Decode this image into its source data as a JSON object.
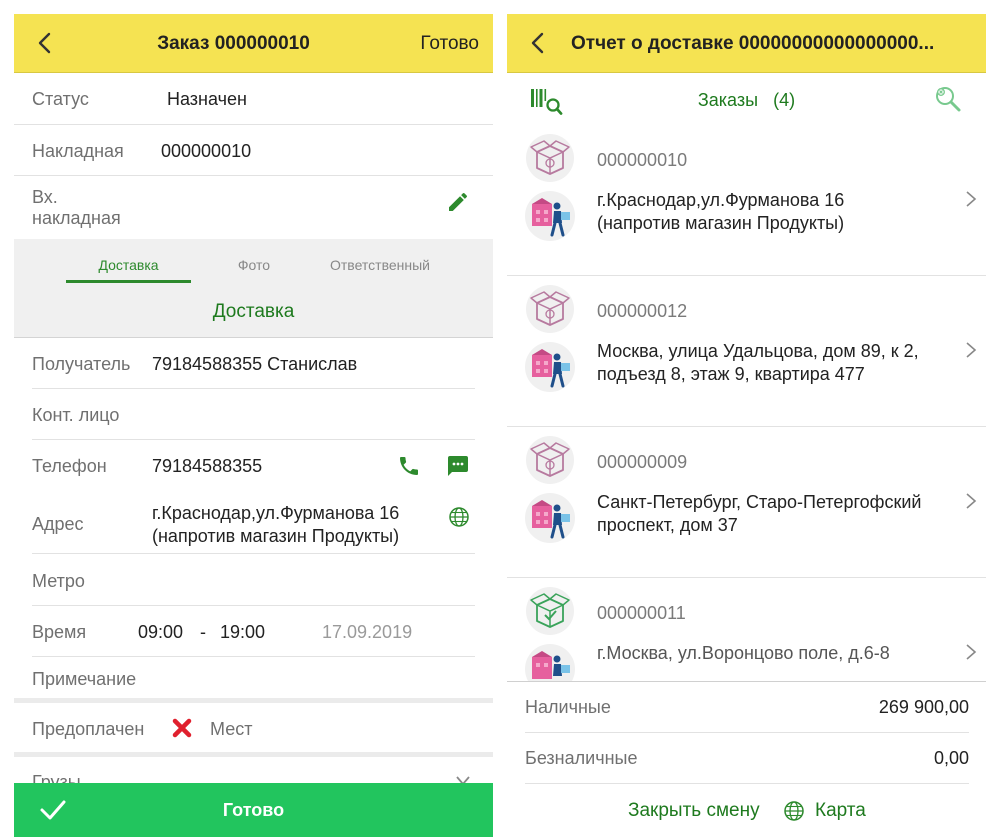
{
  "colors": {
    "header": "#f5e352",
    "accent_green": "#1e7a1e",
    "button_green": "#22c55e",
    "cancel_red": "#e0202e"
  },
  "order_screen": {
    "title": "Заказ 000000010",
    "done_label": "Готово",
    "status_label": "Статус",
    "status_value": "Назначен",
    "invoice_label": "Накладная",
    "invoice_value": "000000010",
    "incoming_invoice_label_line1": "Вх.",
    "incoming_invoice_label_line2": "накладная",
    "tabs": [
      {
        "label": "Доставка"
      },
      {
        "label": "Фото"
      },
      {
        "label": "Ответственный"
      }
    ],
    "active_tab": "Доставка",
    "section_title": "Доставка",
    "recipient_label": "Получатель",
    "recipient_value": "79184588355 Станислав",
    "contact_label": "Конт. лицо",
    "phone_label": "Телефон",
    "phone_value": "79184588355",
    "address_label": "Адрес",
    "address_line1": "г.Краснодар,ул.Фурманова 16",
    "address_line2": "(напротив магазин Продукты)",
    "metro_label": "Метро",
    "time_label": "Время",
    "time_from": "09:00",
    "time_dash": "-",
    "time_to": "19:00",
    "date_value": "17.09.2019",
    "note_label": "Примечание",
    "prepaid_label": "Предоплачен",
    "places_label": "Мест",
    "cargo_label": "Грузы",
    "footer_button_label": "Готово"
  },
  "report_screen": {
    "title": "Отчет о доставке 00000000000000000...",
    "orders_label": "Заказы",
    "orders_count": "(4)",
    "orders": [
      {
        "number": "000000010",
        "address_line1": "г.Краснодар,ул.Фурманова 16",
        "address_line2": "(напротив магазин Продукты)",
        "box_icon": "box-pending-icon"
      },
      {
        "number": "000000012",
        "address_line1": "Москва, улица Удальцова, дом 89, к 2,",
        "address_line2": "подъезд 8, этаж 9, квартира 477",
        "box_icon": "box-pending-icon"
      },
      {
        "number": "000000009",
        "address_line1": "Санкт-Петербург, Старо-Петергофский",
        "address_line2": "проспект, дом 37",
        "box_icon": "box-pending-icon"
      },
      {
        "number": "000000011",
        "address_line1": "г.Москва, ул.Воронцово поле, д.6-8",
        "address_line2": "",
        "box_icon": "box-delivered-icon"
      }
    ],
    "cash_label": "Наличные",
    "cash_value": "269 900,00",
    "cashless_label": "Безналичные",
    "cashless_value": "0,00",
    "close_shift_label": "Закрыть смену",
    "map_label": "Карта"
  }
}
